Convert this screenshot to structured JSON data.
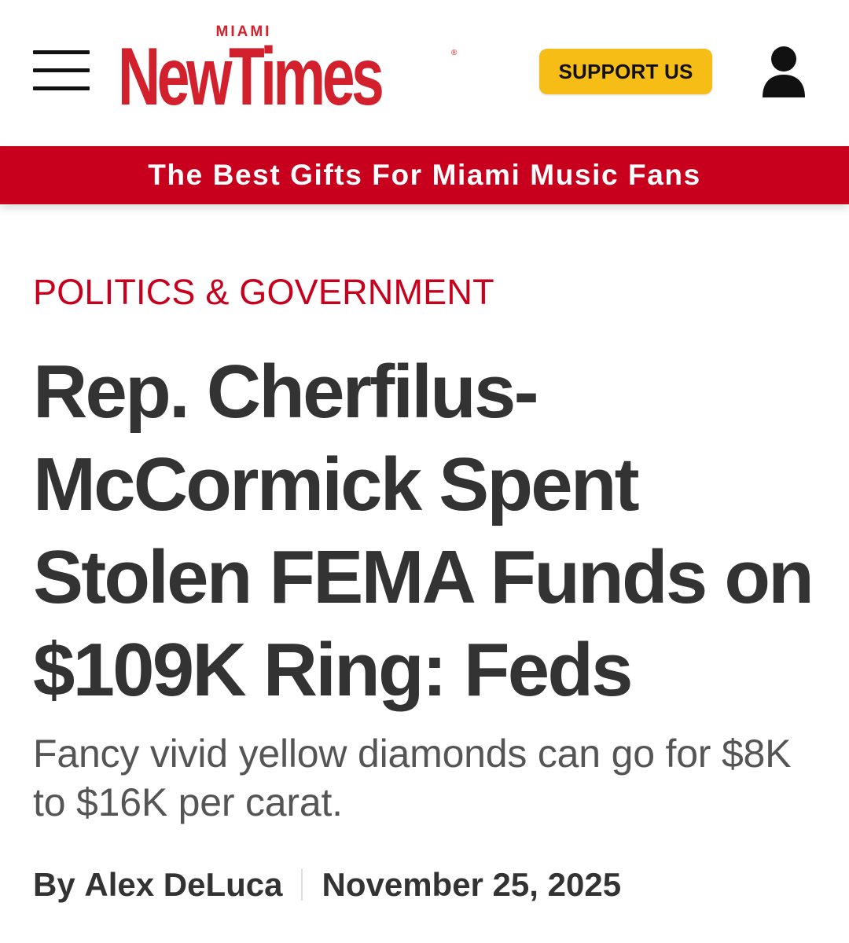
{
  "header": {
    "menu_icon": "hamburger-menu-icon",
    "logo": {
      "top_text": "MIAMI",
      "main_text": "NewTimes",
      "registered_mark": "®"
    },
    "support_label": "SUPPORT US",
    "account_icon": "user-account-icon"
  },
  "promo": {
    "text": "The Best Gifts For Miami Music Fans"
  },
  "article": {
    "category": "POLITICS & GOVERNMENT",
    "headline": "Rep. Cherfilus-McCormick Spent Stolen FEMA Funds on $109K Ring: Feds",
    "dek": "Fancy vivid yellow diamonds can go for $8K to $16K per carat.",
    "byline": {
      "prefix": "By",
      "author": "Alex DeLuca",
      "date": "November 25, 2025"
    }
  },
  "colors": {
    "brand_red": "#d2202d",
    "banner_red": "#c8001e",
    "support_yellow": "#f5bd16",
    "headline_text": "#333333",
    "dek_text": "#555555"
  }
}
